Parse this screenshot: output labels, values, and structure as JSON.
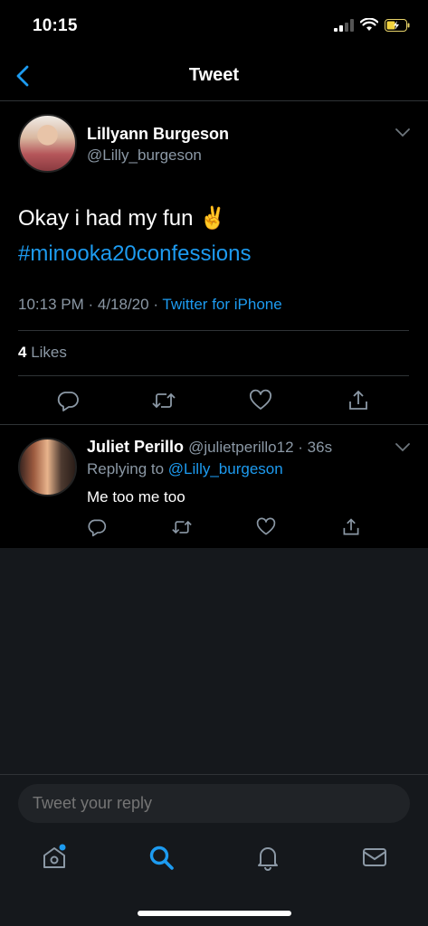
{
  "status_bar": {
    "time": "10:15"
  },
  "nav": {
    "title": "Tweet"
  },
  "tweet": {
    "author_name": "Lillyann Burgeson",
    "author_handle": "@Lilly_burgeson",
    "text": "Okay i had my fun ✌️",
    "hashtag": "#minooka20confessions",
    "time": "10:13 PM · 4/18/20 ·",
    "source": "Twitter for iPhone",
    "likes_count": "4",
    "likes_label": "Likes"
  },
  "reply": {
    "author_name": "Juliet Perillo",
    "author_meta": "@julietperillo12 · 36s",
    "replying_label": "Replying to",
    "replying_to": "@Lilly_burgeson",
    "text": "Me too me too"
  },
  "composer": {
    "placeholder": "Tweet your reply"
  },
  "colors": {
    "accent": "#1d9bf0",
    "muted": "#8b98a5",
    "background": "#000000",
    "panel": "#15181c"
  }
}
